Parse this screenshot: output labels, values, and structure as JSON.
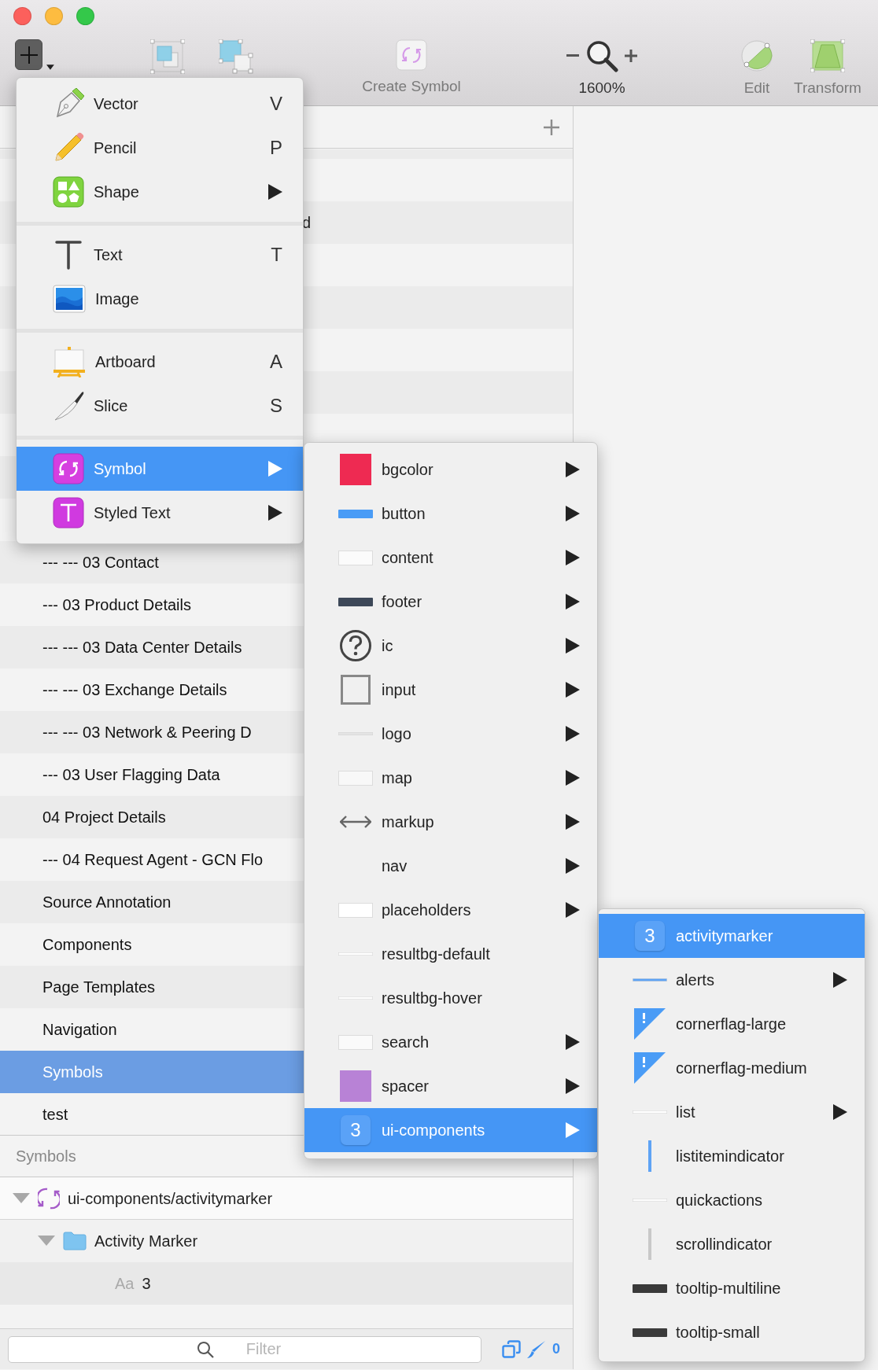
{
  "window": {
    "controls": [
      {
        "color": "#fc605c"
      },
      {
        "color": "#fdbc40"
      },
      {
        "color": "#34c84a"
      }
    ]
  },
  "toolbar": {
    "insert_button": {
      "expanded": true
    },
    "items": [
      {
        "kind": "group"
      },
      {
        "kind": "ungroup"
      },
      {
        "kind": "create-symbol",
        "label": "Create Symbol"
      },
      {
        "kind": "zoom",
        "label": "1600%"
      },
      {
        "kind": "edit",
        "label": "Edit"
      },
      {
        "kind": "transform",
        "label": "Transform"
      }
    ]
  },
  "pages": {
    "covered_fragment": "d",
    "items": [
      {
        "name": "--- --- 03 Contact",
        "selected": false
      },
      {
        "name": "--- 03 Product Details",
        "selected": false
      },
      {
        "name": "--- --- 03 Data Center Details",
        "selected": false
      },
      {
        "name": "--- --- 03 Exchange Details",
        "selected": false
      },
      {
        "name": "--- --- 03 Network & Peering D",
        "selected": false
      },
      {
        "name": "--- 03 User Flagging Data",
        "selected": false
      },
      {
        "name": "04 Project Details",
        "selected": false
      },
      {
        "name": "--- 04 Request Agent - GCN Flo",
        "selected": false
      },
      {
        "name": "Source Annotation",
        "selected": false
      },
      {
        "name": "Components",
        "selected": false
      },
      {
        "name": "Page Templates",
        "selected": false
      },
      {
        "name": "Navigation",
        "selected": false
      },
      {
        "name": "Symbols",
        "selected": true
      },
      {
        "name": "test",
        "selected": false
      }
    ]
  },
  "insert_menu": {
    "groups": [
      [
        {
          "kind": "vector",
          "label": "Vector",
          "shortcut": "V",
          "submenu": false,
          "selected": false
        },
        {
          "kind": "pencil",
          "label": "Pencil",
          "shortcut": "P",
          "submenu": false,
          "selected": false
        },
        {
          "kind": "shape",
          "label": "Shape",
          "submenu": true,
          "selected": false
        }
      ],
      [
        {
          "kind": "text",
          "label": "Text",
          "shortcut": "T",
          "submenu": false,
          "selected": false
        },
        {
          "kind": "image",
          "label": "Image",
          "submenu": false,
          "selected": false
        }
      ],
      [
        {
          "kind": "artboard",
          "label": "Artboard",
          "shortcut": "A",
          "submenu": false,
          "selected": false
        },
        {
          "kind": "slice",
          "label": "Slice",
          "shortcut": "S",
          "submenu": false,
          "selected": false
        }
      ],
      [
        {
          "kind": "symbol",
          "label": "Symbol",
          "submenu": true,
          "selected": true
        },
        {
          "kind": "styled-text",
          "label": "Styled Text",
          "submenu": true,
          "selected": false
        }
      ]
    ]
  },
  "symbol_menu": {
    "items": [
      {
        "kind": "swatch",
        "color": "#ee2a52",
        "label": "bgcolor",
        "submenu": true,
        "selected": false
      },
      {
        "kind": "bar",
        "color": "#4a9cf6",
        "label": "button",
        "submenu": true,
        "selected": false
      },
      {
        "kind": "panel",
        "color": "#fbfbfb",
        "label": "content",
        "submenu": true,
        "selected": false
      },
      {
        "kind": "bar",
        "color": "#3d4858",
        "label": "footer",
        "submenu": true,
        "selected": false
      },
      {
        "kind": "help",
        "label": "ic",
        "submenu": true,
        "selected": false
      },
      {
        "kind": "frame",
        "label": "input",
        "submenu": true,
        "selected": false
      },
      {
        "kind": "line",
        "color": "#e4e4e4",
        "label": "logo",
        "submenu": true,
        "selected": false
      },
      {
        "kind": "panel",
        "color": "#f8f8f8",
        "label": "map",
        "submenu": true,
        "selected": false
      },
      {
        "kind": "arrows",
        "label": "markup",
        "submenu": true,
        "selected": false
      },
      {
        "kind": "none",
        "label": "nav",
        "submenu": true,
        "selected": false
      },
      {
        "kind": "panel",
        "color": "#ffffff",
        "label": "placeholders",
        "submenu": true,
        "selected": false
      },
      {
        "kind": "line",
        "color": "#ffffff",
        "label": "resultbg-default",
        "submenu": false,
        "selected": false
      },
      {
        "kind": "line",
        "color": "#fdfdfd",
        "label": "resultbg-hover",
        "submenu": false,
        "selected": false
      },
      {
        "kind": "panel",
        "color": "#fafafa",
        "label": "search",
        "submenu": true,
        "selected": false
      },
      {
        "kind": "swatch",
        "color": "#b882d6",
        "label": "spacer",
        "submenu": true,
        "selected": false
      },
      {
        "kind": "badge",
        "badge": "3",
        "label": "ui-components",
        "submenu": true,
        "selected": true
      }
    ]
  },
  "ui_components_menu": {
    "items": [
      {
        "kind": "badge",
        "badge": "3",
        "label": "activitymarker",
        "submenu": false,
        "selected": true
      },
      {
        "kind": "line",
        "color": "#5ea3f5",
        "label": "alerts",
        "submenu": true,
        "selected": false
      },
      {
        "kind": "flag",
        "label": "cornerflag-large",
        "submenu": false,
        "selected": false
      },
      {
        "kind": "flag",
        "label": "cornerflag-medium",
        "submenu": false,
        "selected": false
      },
      {
        "kind": "line",
        "color": "#ffffff",
        "label": "list",
        "submenu": true,
        "selected": false
      },
      {
        "kind": "vline",
        "color": "#5ea3f5",
        "label": "listitemindicator",
        "submenu": false,
        "selected": false
      },
      {
        "kind": "line",
        "color": "#fcfcfc",
        "label": "quickactions",
        "submenu": false,
        "selected": false
      },
      {
        "kind": "vline",
        "color": "#c8c8c8",
        "label": "scrollindicator",
        "submenu": false,
        "selected": false
      },
      {
        "kind": "bar",
        "color": "#3a3a3a",
        "label": "tooltip-multiline",
        "submenu": false,
        "selected": false
      },
      {
        "kind": "bar",
        "color": "#3b3b3b",
        "label": "tooltip-small",
        "submenu": false,
        "selected": false
      }
    ]
  },
  "layers": {
    "title": "Symbols",
    "tree": [
      {
        "kind": "symbol",
        "name": "ui-components/activitymarker",
        "expanded": true,
        "children": [
          {
            "kind": "folder",
            "name": "Activity Marker",
            "expanded": true,
            "children": [
              {
                "kind": "text",
                "glyph": "Aa",
                "name": "3"
              }
            ]
          }
        ]
      }
    ]
  },
  "filter": {
    "placeholder": "Filter",
    "count": "0"
  }
}
